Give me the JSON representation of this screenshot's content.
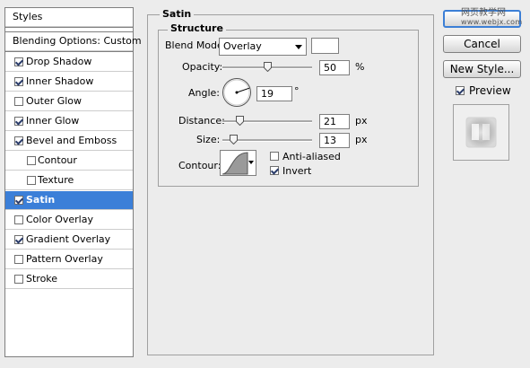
{
  "sidebar": {
    "header": "Styles",
    "blending_options": "Blending Options: Custom",
    "items": [
      {
        "label": "Drop Shadow",
        "checked": true
      },
      {
        "label": "Inner Shadow",
        "checked": true
      },
      {
        "label": "Outer Glow",
        "checked": false
      },
      {
        "label": "Inner Glow",
        "checked": true
      },
      {
        "label": "Bevel and Emboss",
        "checked": true
      },
      {
        "label": "Contour",
        "checked": false
      },
      {
        "label": "Texture",
        "checked": false
      },
      {
        "label": "Satin",
        "checked": true,
        "selected": true
      },
      {
        "label": "Color Overlay",
        "checked": false
      },
      {
        "label": "Gradient Overlay",
        "checked": true
      },
      {
        "label": "Pattern Overlay",
        "checked": false
      },
      {
        "label": "Stroke",
        "checked": false
      }
    ]
  },
  "satin": {
    "title": "Satin",
    "structure_title": "Structure",
    "blend_mode_label": "Blend Mode:",
    "blend_mode_value": "Overlay",
    "blend_color": "#ffffff",
    "opacity_label": "Opacity:",
    "opacity_value": "50",
    "opacity_unit": "%",
    "opacity_fraction": 0.5,
    "angle_label": "Angle:",
    "angle_value": "19",
    "angle_unit": "°",
    "distance_label": "Distance:",
    "distance_value": "21",
    "distance_unit": "px",
    "size_label": "Size:",
    "size_value": "13",
    "size_unit": "px",
    "contour_label": "Contour:",
    "anti_aliased_label": "Anti-aliased",
    "anti_aliased_checked": false,
    "invert_label": "Invert",
    "invert_checked": true
  },
  "buttons": {
    "ok": "",
    "cancel": "Cancel",
    "new_style": "New Style..."
  },
  "preview": {
    "label": "Preview",
    "checked": true
  },
  "watermark": {
    "line1": "网页教学网",
    "line2": "www.webjx.com"
  },
  "colors": {
    "selected_row": "#3b7fd8",
    "default_button_border": "#3c7fd6"
  }
}
